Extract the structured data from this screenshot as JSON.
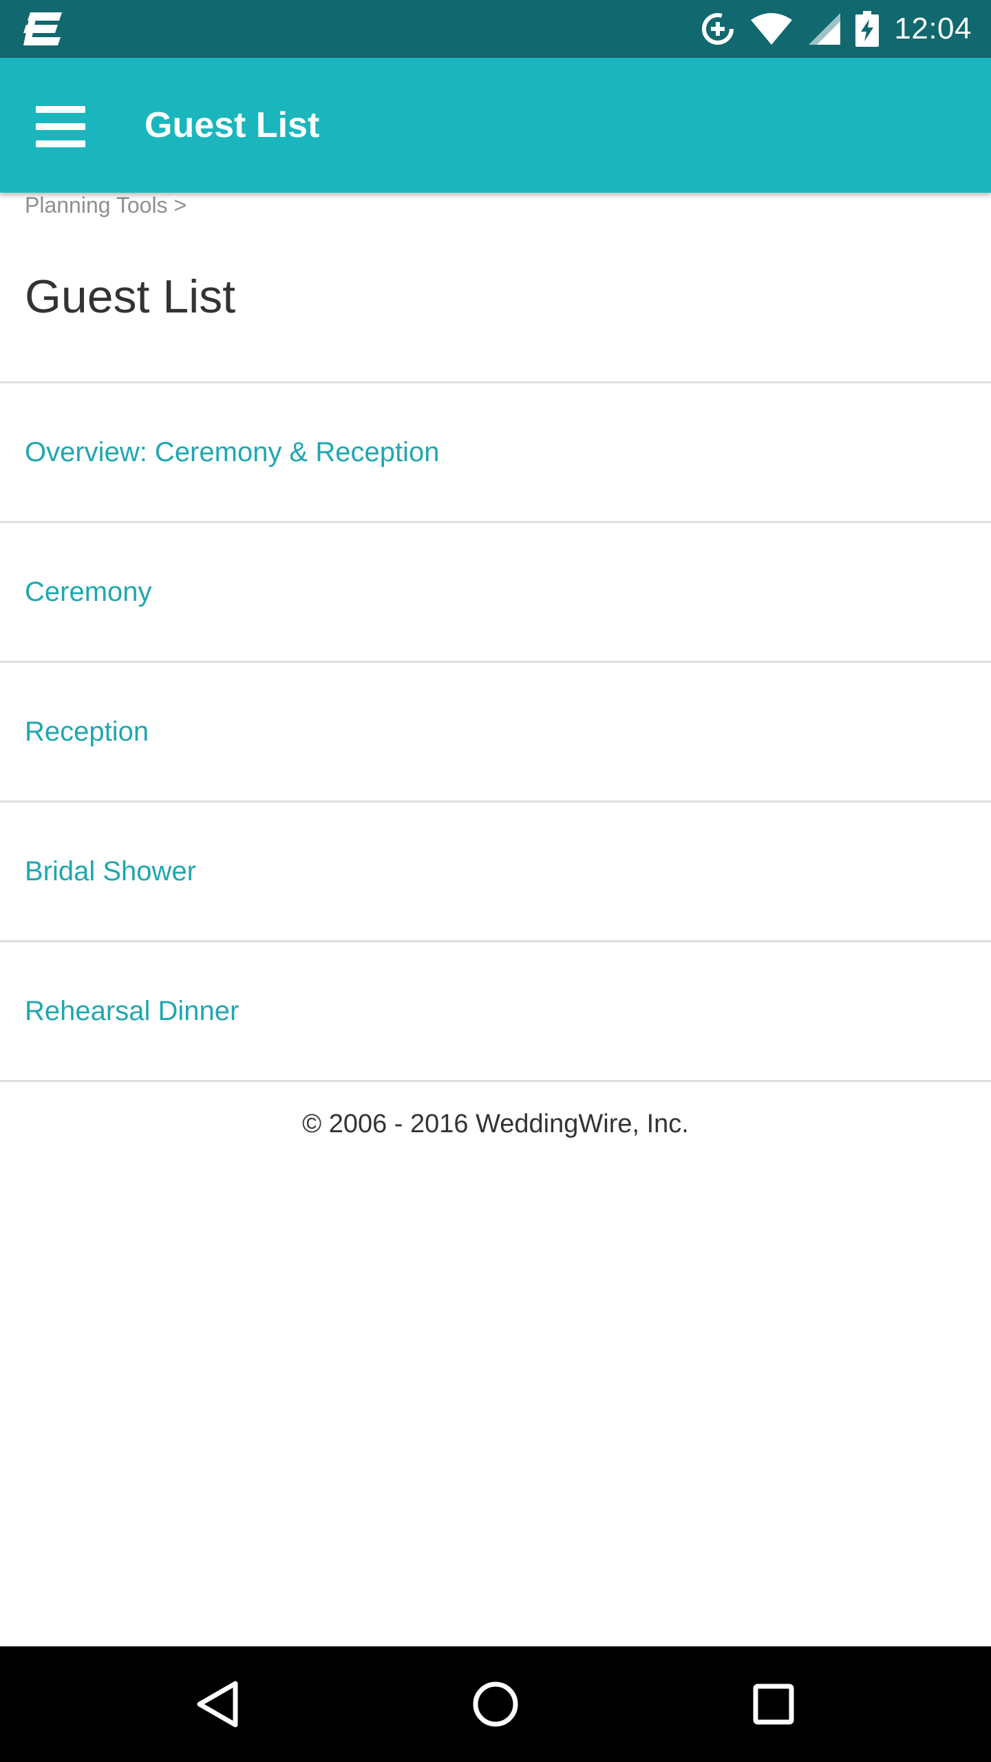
{
  "status_bar": {
    "time": "12:04",
    "icons": [
      "app-logo-icon",
      "data-saver-icon",
      "wifi-icon",
      "cell-signal-icon",
      "battery-charging-icon"
    ]
  },
  "app_bar": {
    "title": "Guest List",
    "menu_icon": "hamburger-menu-icon",
    "background": "#1bb6bd"
  },
  "breadcrumb": {
    "label": "Planning Tools",
    "separator": ">"
  },
  "page": {
    "title": "Guest List"
  },
  "nav_items": [
    {
      "label": "Overview: Ceremony & Reception"
    },
    {
      "label": "Ceremony"
    },
    {
      "label": "Reception"
    },
    {
      "label": "Bridal Shower"
    },
    {
      "label": "Rehearsal Dinner"
    }
  ],
  "footer": {
    "text": "© 2006 - 2016 WeddingWire, Inc."
  },
  "system_nav": {
    "icons": [
      "back-icon",
      "home-icon",
      "recents-icon"
    ]
  },
  "colors": {
    "status_bar": "#11686f",
    "accent": "#1bb6bd",
    "link": "#1fa7b0"
  }
}
